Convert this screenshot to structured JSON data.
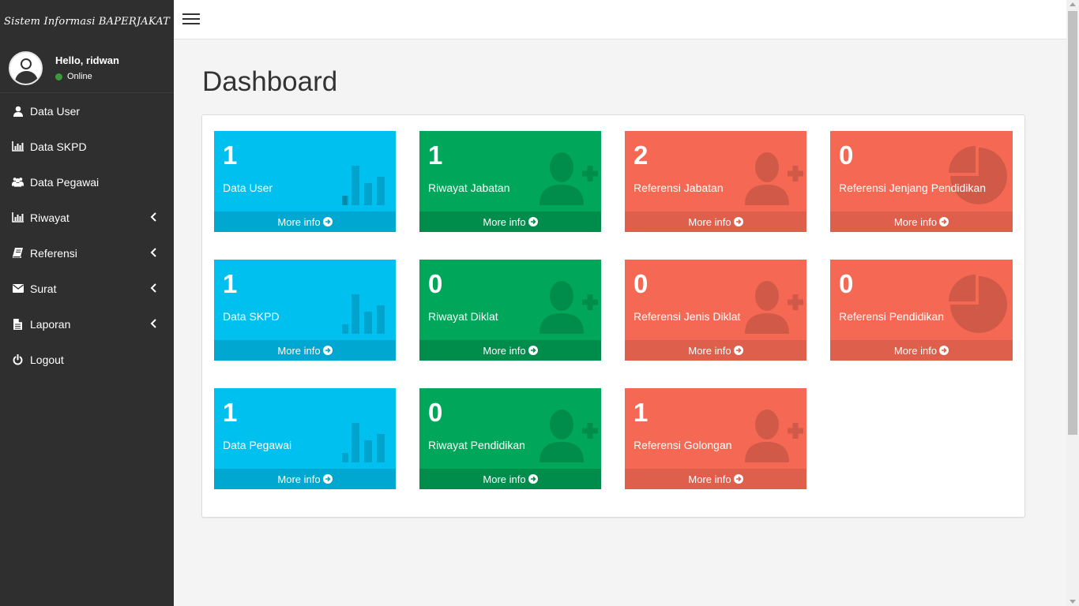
{
  "app": {
    "brand": "Sistem Informasi BAPERJAKAT"
  },
  "user": {
    "greeting": "Hello, ridwan",
    "status": "Online"
  },
  "sidebar": {
    "items": [
      {
        "label": "Data User",
        "icon": "user-icon"
      },
      {
        "label": "Data SKPD",
        "icon": "bar-chart-icon"
      },
      {
        "label": "Data Pegawai",
        "icon": "users-icon"
      },
      {
        "label": "Riwayat",
        "icon": "bar-chart-icon",
        "has_submenu": true
      },
      {
        "label": "Referensi",
        "icon": "book-icon",
        "has_submenu": true
      },
      {
        "label": "Surat",
        "icon": "envelope-icon",
        "has_submenu": true
      },
      {
        "label": "Laporan",
        "icon": "file-icon",
        "has_submenu": true
      },
      {
        "label": "Logout",
        "icon": "power-icon"
      }
    ]
  },
  "page": {
    "title": "Dashboard"
  },
  "boxes": [
    {
      "count": "1",
      "label": "Data User",
      "more": "More info",
      "color": "blue",
      "icon": "bar-chart-icon"
    },
    {
      "count": "1",
      "label": "Riwayat Jabatan",
      "more": "More info",
      "color": "green",
      "icon": "user-plus-icon"
    },
    {
      "count": "2",
      "label": "Referensi Jabatan",
      "more": "More info",
      "color": "red",
      "icon": "user-plus-icon"
    },
    {
      "count": "0",
      "label": "Referensi Jenjang Pendidikan",
      "more": "More info",
      "color": "red",
      "icon": "pie-chart-icon"
    },
    {
      "count": "1",
      "label": "Data SKPD",
      "more": "More info",
      "color": "blue",
      "icon": "bar-chart-icon"
    },
    {
      "count": "0",
      "label": "Riwayat Diklat",
      "more": "More info",
      "color": "green",
      "icon": "user-plus-icon"
    },
    {
      "count": "0",
      "label": "Referensi Jenis Diklat",
      "more": "More info",
      "color": "red",
      "icon": "user-plus-icon"
    },
    {
      "count": "0",
      "label": "Referensi Pendidikan",
      "more": "More info",
      "color": "red",
      "icon": "pie-chart-icon"
    },
    {
      "count": "1",
      "label": "Data Pegawai",
      "more": "More info",
      "color": "blue",
      "icon": "bar-chart-icon"
    },
    {
      "count": "0",
      "label": "Riwayat Pendidikan",
      "more": "More info",
      "color": "green",
      "icon": "user-plus-icon"
    },
    {
      "count": "1",
      "label": "Referensi Golongan",
      "more": "More info",
      "color": "red",
      "icon": "user-plus-icon"
    }
  ],
  "colors": {
    "sidebar_bg": "#2f2f2f",
    "blue": "#00c0ef",
    "green": "#00a65a",
    "red": "#f56954",
    "online": "#3c9a3c"
  }
}
